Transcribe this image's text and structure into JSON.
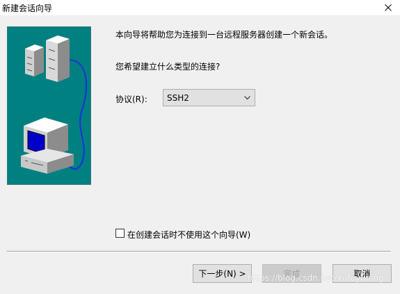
{
  "window": {
    "title": "新建会话向导"
  },
  "text": {
    "intro": "本向导将帮助您为连接到一台远程服务器创建一个新会话。",
    "question": "您希望建立什么类型的连接?"
  },
  "protocol": {
    "label": "协议(R):",
    "selected": "SSH2"
  },
  "checkbox": {
    "label": "在创建会话时不使用这个向导(W)",
    "checked": false
  },
  "buttons": {
    "next": "下一步(N) >",
    "finish": "完成",
    "cancel": "取消"
  },
  "watermark": "https://blog.csdn.net/xufuyuning",
  "colors": {
    "illustration_bg": "#008080",
    "monitor_screen": "#0000c8",
    "cable": "#1e2ee0"
  }
}
